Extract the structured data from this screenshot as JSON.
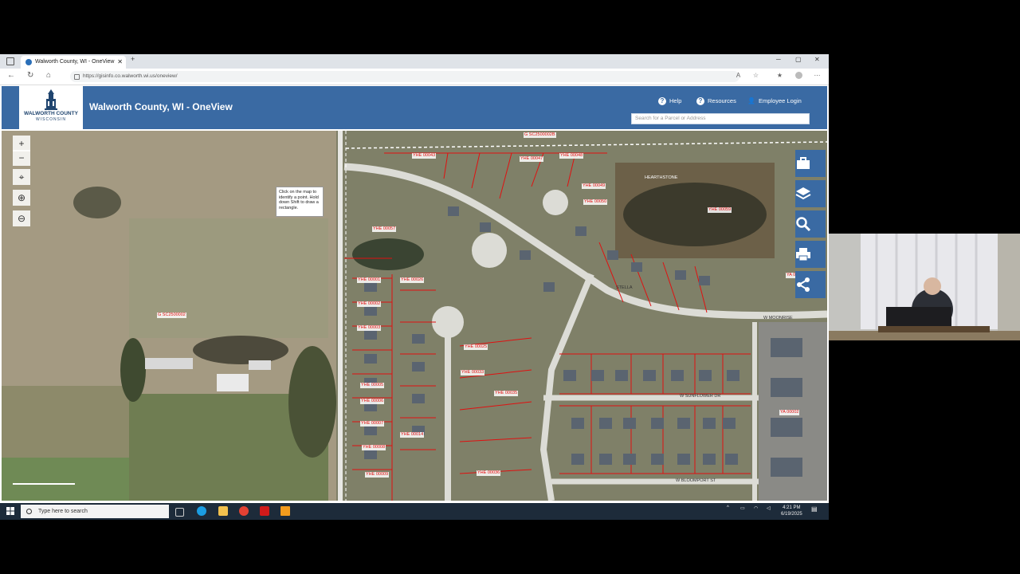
{
  "browser": {
    "tab_title": "Walworth County, WI - OneView",
    "url": "https://gisinfo.co.walworth.wi.us/oneview/"
  },
  "header": {
    "logo_line1": "WALWORTH COUNTY",
    "logo_line2": "WISCONSIN",
    "title": "Walworth County, WI - OneView",
    "help": "Help",
    "resources": "Resources",
    "employee_login": "Employee Login",
    "search_placeholder": "Search for a Parcel or Address"
  },
  "map": {
    "tooltip": "Click on the map to identify a point. Hold down Shift to draw a rectangle.",
    "zoom_in": "+",
    "zoom_out": "−",
    "parcel_labels": [
      "G SC2500002B",
      "G SC2500002",
      "YHE 00043",
      "YHE 00047",
      "YHE 00048",
      "YHE 00049",
      "YHE 00050",
      "YHE 00059",
      "YHE 00057",
      "YHE 00001",
      "YHE 00002",
      "YHE 00003",
      "YHE 00005",
      "YHE 00006",
      "YHE 00007",
      "YHE 00008",
      "YHE 00009",
      "YHE 00014",
      "YHE 00026",
      "YHE 00025",
      "YHE 00033",
      "YHE 00035",
      "YHE 00036",
      "YA 00024",
      "YA 00002"
    ],
    "place_labels": [
      "HEARTHSTONE",
      "STELLA",
      "W SUNFLOWER DR",
      "W BLOOMPORT ST",
      "W MOONRISE"
    ]
  },
  "taskbar": {
    "search_placeholder": "Type here to search",
    "time": "4:21 PM",
    "date": "6/19/2025"
  },
  "colors": {
    "header_blue": "#3a6aa3",
    "parcel_line": "#e01010",
    "taskbar": "#1d2b3a"
  }
}
